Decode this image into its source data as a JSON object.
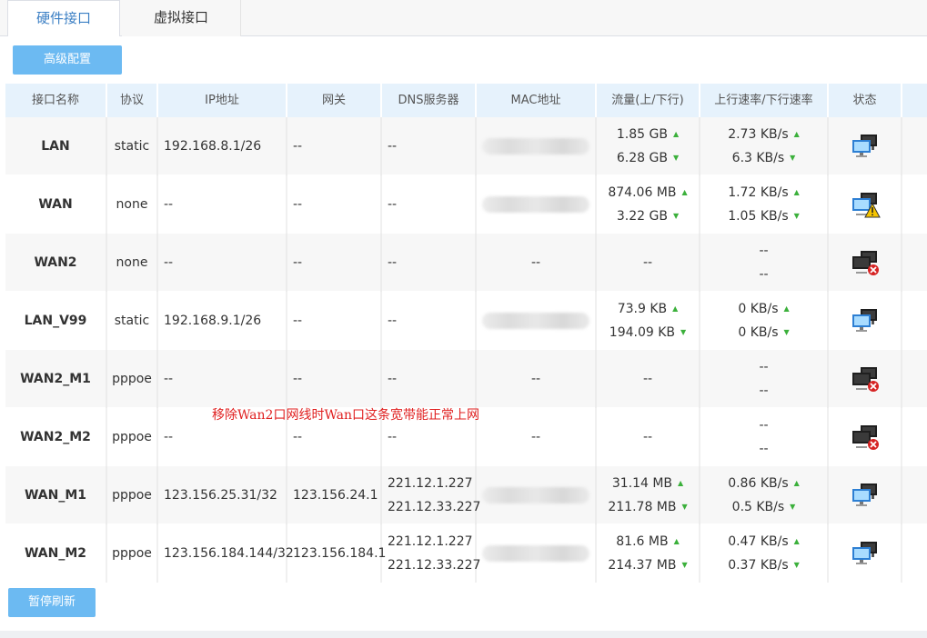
{
  "tabs": [
    {
      "label": "硬件接口",
      "active": true
    },
    {
      "label": "虚拟接口",
      "active": false
    }
  ],
  "buttons": {
    "advanced": "高级配置",
    "pause": "暂停刷新"
  },
  "columns": [
    "接口名称",
    "协议",
    "IP地址",
    "网关",
    "DNS服务器",
    "MAC地址",
    "流量(上/下行)",
    "上行速率/下行速率",
    "状态"
  ],
  "rows": [
    {
      "name": "LAN",
      "proto": "static",
      "ip": "192.168.8.1/26",
      "gw": "--",
      "dns1": "--",
      "dns2": "",
      "mac": "blurred",
      "up": "1.85 GB",
      "down": "6.28 GB",
      "rate_up": "2.73 KB/s",
      "rate_down": "6.3 KB/s",
      "status": "connected"
    },
    {
      "name": "WAN",
      "proto": "none",
      "ip": "--",
      "gw": "--",
      "dns1": "--",
      "dns2": "",
      "mac": "blurred",
      "up": "874.06 MB",
      "down": "3.22 GB",
      "rate_up": "1.72 KB/s",
      "rate_down": "1.05 KB/s",
      "status": "warning"
    },
    {
      "name": "WAN2",
      "proto": "none",
      "ip": "--",
      "gw": "--",
      "dns1": "--",
      "dns2": "",
      "mac": "--",
      "up": "--",
      "down": "",
      "rate_up": "--",
      "rate_down": "--",
      "status": "disconnected"
    },
    {
      "name": "LAN_V99",
      "proto": "static",
      "ip": "192.168.9.1/26",
      "gw": "--",
      "dns1": "--",
      "dns2": "",
      "mac": "blurred",
      "up": "73.9 KB",
      "down": "194.09 KB",
      "rate_up": "0 KB/s",
      "rate_down": "0 KB/s",
      "status": "connected"
    },
    {
      "name": "WAN2_M1",
      "proto": "pppoe",
      "ip": "--",
      "gw": "--",
      "dns1": "--",
      "dns2": "",
      "mac": "--",
      "up": "--",
      "down": "",
      "rate_up": "--",
      "rate_down": "--",
      "status": "disconnected"
    },
    {
      "name": "WAN2_M2",
      "proto": "pppoe",
      "ip": "--",
      "gw": "--",
      "dns1": "--",
      "dns2": "",
      "mac": "--",
      "up": "--",
      "down": "",
      "rate_up": "--",
      "rate_down": "--",
      "status": "disconnected"
    },
    {
      "name": "WAN_M1",
      "proto": "pppoe",
      "ip": "123.156.25.31/32",
      "gw": "123.156.24.1",
      "dns1": "221.12.1.227",
      "dns2": "221.12.33.227",
      "mac": "blurred",
      "up": "31.14 MB",
      "down": "211.78 MB",
      "rate_up": "0.86 KB/s",
      "rate_down": "0.5 KB/s",
      "status": "connected"
    },
    {
      "name": "WAN_M2",
      "proto": "pppoe",
      "ip": "123.156.184.144/32",
      "gw": "123.156.184.1",
      "dns1": "221.12.1.227",
      "dns2": "221.12.33.227",
      "mac": "blurred",
      "up": "81.6 MB",
      "down": "214.37 MB",
      "rate_up": "0.47 KB/s",
      "rate_down": "0.37 KB/s",
      "status": "connected"
    }
  ],
  "annotation": "移除Wan2口网线时Wan口这条宽带能正常上网"
}
